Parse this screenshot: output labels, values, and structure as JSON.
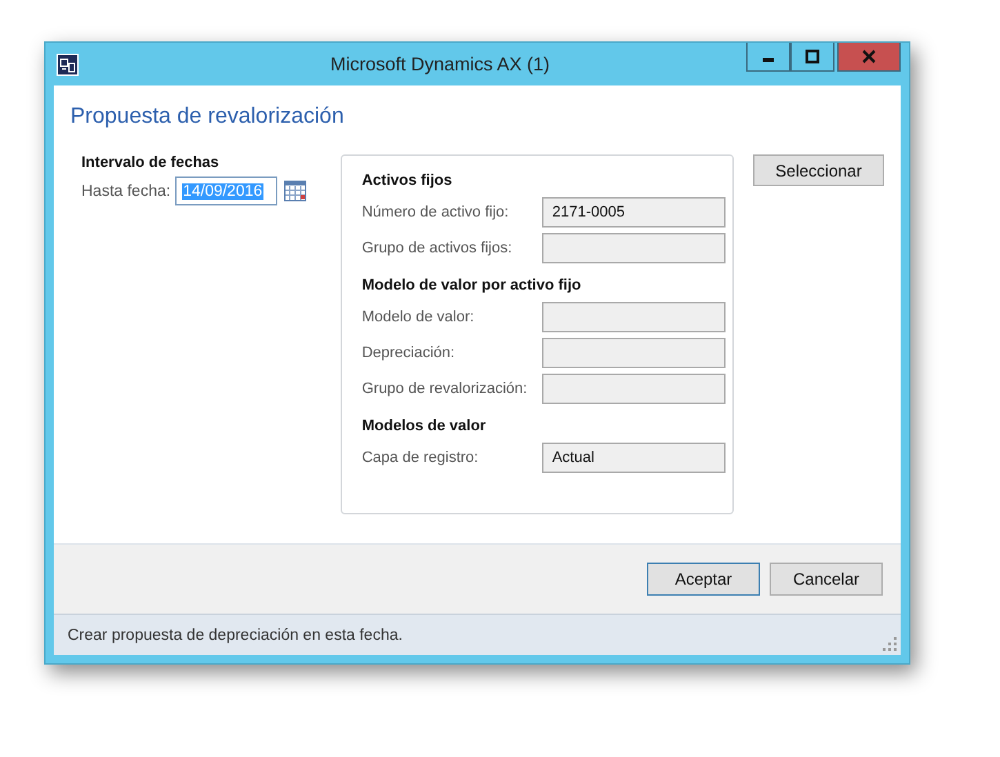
{
  "window": {
    "title": "Microsoft Dynamics AX (1)"
  },
  "dialog_title": "Propuesta de revalorización",
  "date_group": {
    "heading": "Intervalo de fechas",
    "label": "Hasta fecha:",
    "value": "14/09/2016",
    "text_selected": true
  },
  "sections": [
    {
      "heading": "Activos fijos",
      "fields": [
        {
          "label": "Número de activo fijo:",
          "value": "2171-0005"
        },
        {
          "label": "Grupo de activos fijos:"
        }
      ]
    },
    {
      "heading": "Modelo de valor por activo fijo",
      "fields": [
        {
          "label": "Modelo de valor:"
        },
        {
          "label": "Depreciación:"
        },
        {
          "label": "Grupo de revalorización:"
        }
      ]
    },
    {
      "heading": "Modelos de valor",
      "fields": [
        {
          "label": "Capa de registro:",
          "value": "Actual"
        }
      ]
    }
  ],
  "select_button": "Seleccionar",
  "buttons": [
    {
      "label": "Aceptar",
      "default": true
    },
    {
      "label": "Cancelar",
      "default": false
    }
  ],
  "status_bar": "Crear propuesta de depreciación en esta fecha."
}
